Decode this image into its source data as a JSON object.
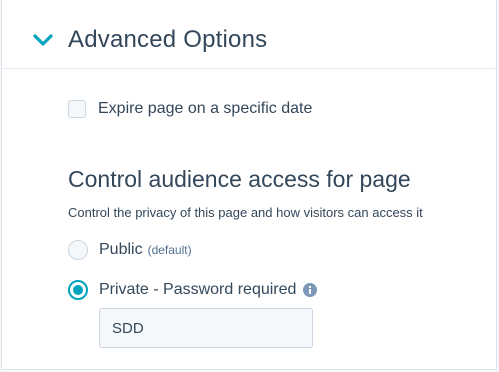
{
  "advanced": {
    "title": "Advanced Options",
    "toggle_icon": "chevron-down-icon",
    "accent_color": "#00a4bd"
  },
  "expire": {
    "label": "Expire page on a specific date",
    "checked": false
  },
  "access": {
    "title": "Control audience access for page",
    "description": "Control the privacy of this page and how visitors can access it",
    "options": [
      {
        "label": "Public",
        "sublabel": "(default)",
        "selected": false
      },
      {
        "label": "Private - Password required",
        "info_icon": "info-icon",
        "selected": true
      }
    ],
    "password_value": "SDD"
  }
}
